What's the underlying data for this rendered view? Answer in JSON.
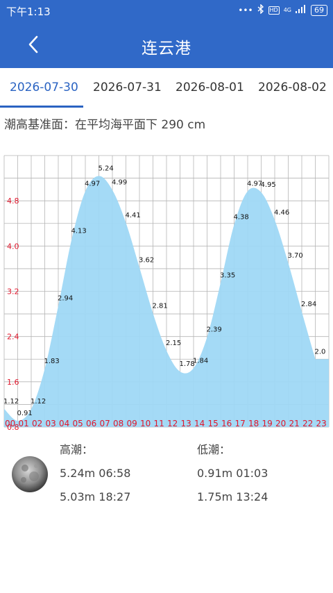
{
  "status_bar": {
    "time": "下午1:13",
    "network": "4G",
    "battery": "69",
    "icons": [
      "dots-icon",
      "bluetooth-icon",
      "hd-icon",
      "signal-icon",
      "battery-icon"
    ]
  },
  "header": {
    "title": "连云港",
    "back_icon": "chevron-left-icon"
  },
  "tabs": [
    {
      "label": "2026-07-30",
      "active": true
    },
    {
      "label": "2026-07-31",
      "active": false
    },
    {
      "label": "2026-08-01",
      "active": false
    },
    {
      "label": "2026-08-02",
      "active": false
    }
  ],
  "datum_text": "潮高基准面：在平均海平面下 290 cm",
  "colors": {
    "primary": "#3069c8",
    "tab_active": "#2a63c2",
    "area_fill": "#9fd8f5",
    "axis_label": "#e0162b",
    "grid": "#b5b5b5"
  },
  "chart_data": {
    "type": "area",
    "ylim": [
      0.8,
      5.6
    ],
    "yticks": [
      "0.8",
      "1.6",
      "2.4",
      "3.2",
      "4.0",
      "4.8"
    ],
    "x": [
      "00",
      "01",
      "02",
      "03",
      "04",
      "05",
      "06",
      "07",
      "08",
      "09",
      "10",
      "11",
      "12",
      "13",
      "14",
      "15",
      "16",
      "17",
      "18",
      "19",
      "20",
      "21",
      "22",
      "23"
    ],
    "values": [
      1.12,
      0.91,
      1.12,
      1.83,
      2.94,
      4.13,
      4.97,
      5.24,
      4.99,
      4.41,
      3.62,
      2.81,
      2.15,
      1.78,
      1.84,
      2.39,
      3.35,
      4.38,
      4.97,
      4.95,
      4.46,
      3.7,
      2.84,
      2.0
    ],
    "labels": [
      "1.12",
      "0.91",
      "1.12",
      "1.83",
      "2.94",
      "4.13",
      "4.97",
      "5.24",
      "4.99",
      "4.41",
      "3.62",
      "2.81",
      "2.15",
      "1.78",
      "1.84",
      "2.39",
      "3.35",
      "4.38",
      "4.97",
      "4.95",
      "4.46",
      "3.70",
      "2.84",
      "2.0"
    ],
    "grid": true
  },
  "tides": {
    "moon_icon": "moon-phase-icon",
    "high_label": "高潮：",
    "high": [
      "5.24m 06:58",
      "5.03m 18:27"
    ],
    "low_label": "低潮：",
    "low": [
      "0.91m 01:03",
      "1.75m 13:24"
    ]
  }
}
